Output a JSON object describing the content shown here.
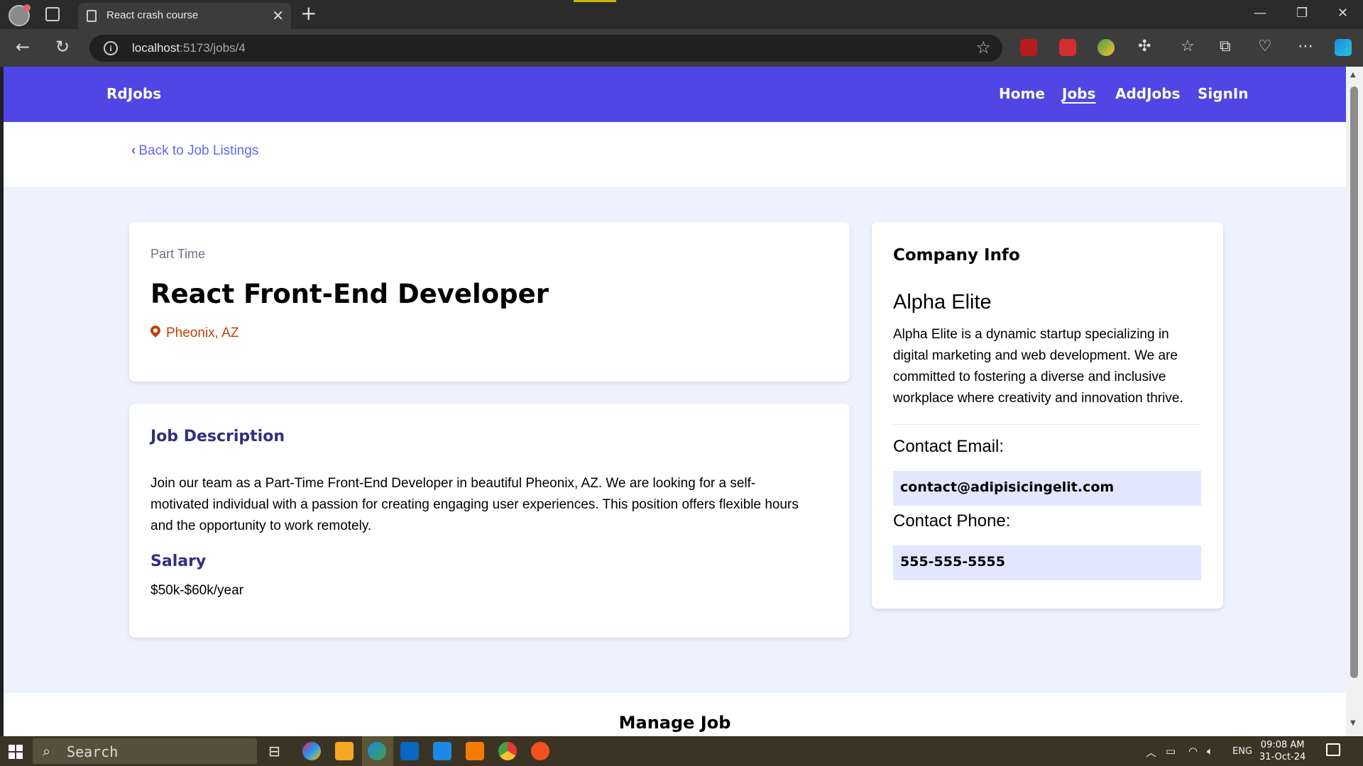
{
  "browser": {
    "tab_title": "React crash course",
    "url_host": "localhost",
    "url_path": ":5173/jobs/4"
  },
  "nav": {
    "brand": "RdJobs",
    "links": [
      "Home",
      "Jobs",
      "AddJobs",
      "SignIn"
    ],
    "active": "Jobs"
  },
  "back_link": "Back to Job Listings",
  "job": {
    "type": "Part Time",
    "title": "React Front-End Developer",
    "location": "Pheonix, AZ",
    "description_heading": "Job Description",
    "description": "Join our team as a Part-Time Front-End Developer in beautiful Pheonix, AZ. We are looking for a self-motivated individual with a passion for creating engaging user experiences. This position offers flexible hours and the opportunity to work remotely.",
    "salary_heading": "Salary",
    "salary": "$50k-$60k/year"
  },
  "company": {
    "heading": "Company Info",
    "name": "Alpha Elite",
    "description": "Alpha Elite is a dynamic startup specializing in digital marketing and web development. We are committed to fostering a diverse and inclusive workplace where creativity and innovation thrive.",
    "email_label": "Contact Email:",
    "email": "contact@adipisicingelit.com",
    "phone_label": "Contact Phone:",
    "phone": "555-555-5555"
  },
  "manage": {
    "title": "Manage Job"
  },
  "taskbar": {
    "search_placeholder": "Search",
    "language": "ENG",
    "time": "09:08 AM",
    "date": "31-Oct-24"
  },
  "colors": {
    "navbar": "#4f46e5",
    "page_bg": "#eef2ff",
    "accent_text": "#312e81",
    "location": "#c2410c",
    "contact_box": "#e0e7ff"
  }
}
